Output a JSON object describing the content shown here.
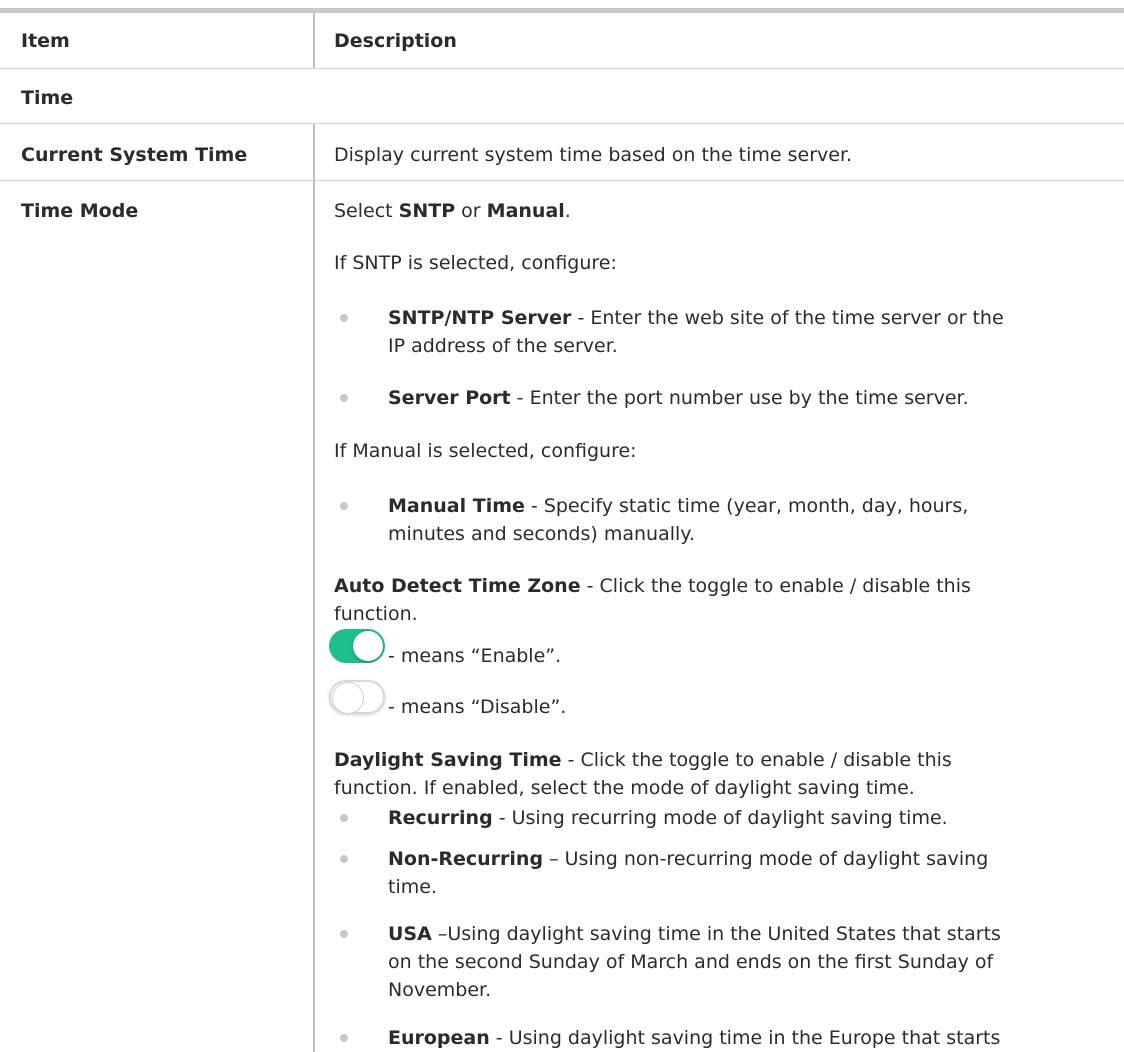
{
  "header": {
    "item": "Item",
    "description": "Description"
  },
  "section": {
    "title": "Time"
  },
  "rows": {
    "current_time": {
      "label": "Current System Time",
      "text": "Display current system time based on the time server."
    },
    "time_mode": {
      "label": "Time Mode",
      "select_prefix": "Select ",
      "select_sntp": "SNTP",
      "select_or": " or ",
      "select_manual": "Manual",
      "select_end": ".",
      "sntp_intro": "If SNTP is selected, configure:",
      "sntp_items": [
        {
          "name": "SNTP/NTP Server",
          "lines": [
            " - Enter the web site of the time server or the",
            "IP address of the server."
          ]
        },
        {
          "name": "Server Port",
          "lines": [
            " - Enter the port number use by the time server."
          ]
        }
      ],
      "manual_intro": "If Manual is selected, configure:",
      "manual_items": [
        {
          "name": "Manual Time",
          "lines": [
            " - Specify static time (year, month, day, hours,",
            "minutes and seconds) manually."
          ]
        }
      ],
      "auto_detect": {
        "name": "Auto Detect Time Zone",
        "lines": [
          " - Click the toggle to enable / disable this",
          "function."
        ]
      },
      "toggle_enable_text": "- means “Enable”.",
      "toggle_disable_text": "- means “Disable”.",
      "daylight": {
        "name": "Daylight Saving Time",
        "lines": [
          " - Click the toggle to enable / disable this",
          "function. If enabled, select the mode of daylight saving time."
        ]
      },
      "dst_items": [
        {
          "name": "Recurring",
          "lines": [
            " - Using recurring mode of daylight saving time."
          ]
        },
        {
          "name": "Non-Recurring",
          "lines": [
            " – Using non-recurring mode of daylight saving",
            "time."
          ]
        },
        {
          "name": "USA",
          "lines": [
            " –Using daylight saving time in the United States that starts",
            "on the second Sunday of March and ends on the first Sunday of",
            "November."
          ]
        },
        {
          "name": "European",
          "lines": [
            " - Using daylight saving time in the Europe that starts"
          ]
        }
      ]
    }
  },
  "colors": {
    "toggle_on": "#1dbf8e",
    "rule": "#c9c9c9"
  }
}
